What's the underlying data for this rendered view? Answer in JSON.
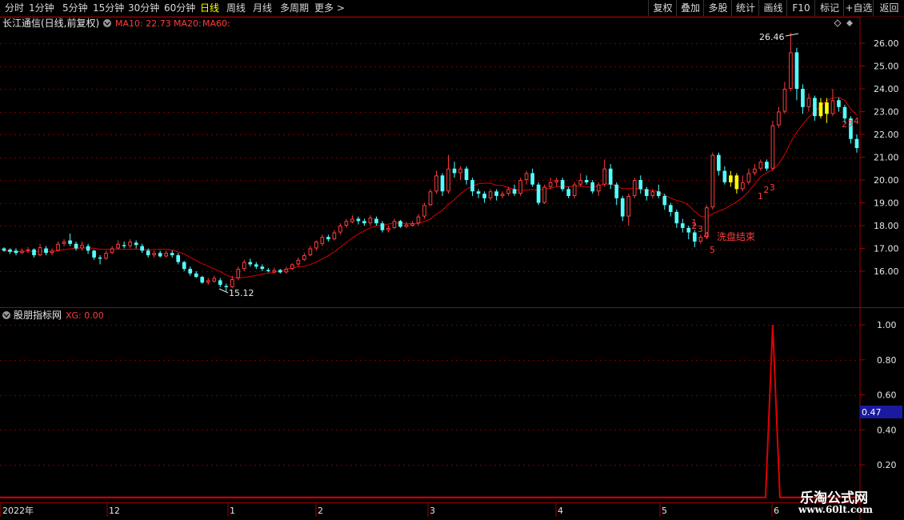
{
  "toolbar": {
    "left_items": [
      "分时",
      "1分钟",
      "5分钟",
      "15分钟",
      "30分钟",
      "60分钟",
      "日线",
      "周线",
      "月线",
      "多周期",
      "更多 >"
    ],
    "active": "日线",
    "right_items": [
      "复权",
      "叠加",
      "多股",
      "统计",
      "画线",
      "F10",
      "标记",
      "+自选",
      "返回"
    ]
  },
  "main_pane": {
    "stock": "长江通信(日线,前复权)",
    "ma10_label": "MA10: 22.73",
    "ma20_label": "MA20:",
    "ma60_label": "MA60:",
    "high_label": "26.46",
    "low_label": "15.12",
    "annotation": "洗盘结束",
    "counts": [
      "1",
      "2",
      "3",
      "4",
      "5",
      "1",
      "2",
      "3",
      "2",
      "3",
      "4"
    ],
    "y_ticks": [
      "26.00",
      "25.00",
      "24.00",
      "23.00",
      "22.00",
      "21.00",
      "20.00",
      "19.00",
      "18.00",
      "17.00",
      "16.00"
    ]
  },
  "sub_pane": {
    "name": "股朋指标网",
    "xg_label": "XG: 0.00",
    "y_ticks": [
      "1.00",
      "0.80",
      "0.60",
      "0.40",
      "0.20"
    ],
    "cursor_value": "0.47"
  },
  "x_axis": {
    "labels": [
      "2022年",
      "12",
      "1",
      "2",
      "3",
      "4",
      "5",
      "6"
    ]
  },
  "watermark": {
    "line1": "乐淘公式网",
    "line2": "www.60lt.com"
  },
  "colors": {
    "up": "#ff3c3c",
    "down": "#54ffff",
    "ma10": "#e00000",
    "signal": "#ffff00",
    "grid": "#7a0000",
    "axis_text": "#e6e6e6"
  },
  "chart_data": {
    "type": "candlestick",
    "price_range": [
      15.12,
      26.46
    ],
    "indicator": {
      "name": "XG",
      "ylim": [
        0,
        1.0
      ],
      "spike_value": 1.0,
      "spike_at_candle_index": 128
    },
    "candles": [
      [
        17.0,
        16.9,
        17.05,
        16.85
      ],
      [
        16.95,
        16.85,
        17.0,
        16.75
      ],
      [
        16.9,
        16.8,
        17.0,
        16.7
      ],
      [
        16.8,
        16.9,
        17.0,
        16.75
      ],
      [
        16.9,
        16.95,
        17.05,
        16.8
      ],
      [
        16.95,
        16.7,
        17.0,
        16.6
      ],
      [
        16.7,
        17.05,
        17.2,
        16.65
      ],
      [
        17.0,
        16.8,
        17.1,
        16.7
      ],
      [
        16.8,
        16.9,
        17.0,
        16.7
      ],
      [
        16.9,
        17.2,
        17.3,
        16.85
      ],
      [
        17.2,
        17.3,
        17.4,
        17.1
      ],
      [
        17.35,
        17.2,
        17.65,
        17.1
      ],
      [
        17.2,
        17.0,
        17.3,
        16.9
      ],
      [
        17.0,
        17.15,
        17.3,
        16.9
      ],
      [
        17.1,
        16.9,
        17.2,
        16.75
      ],
      [
        16.9,
        16.6,
        16.95,
        16.5
      ],
      [
        16.6,
        16.55,
        16.7,
        16.3
      ],
      [
        16.55,
        16.8,
        16.9,
        16.5
      ],
      [
        16.8,
        17.0,
        17.1,
        16.75
      ],
      [
        17.0,
        17.2,
        17.35,
        16.95
      ],
      [
        17.15,
        17.1,
        17.3,
        17.0
      ],
      [
        17.1,
        17.3,
        17.4,
        17.0
      ],
      [
        17.25,
        17.15,
        17.35,
        17.0
      ],
      [
        17.1,
        16.9,
        17.2,
        16.8
      ],
      [
        16.9,
        16.7,
        17.0,
        16.6
      ],
      [
        16.7,
        16.8,
        16.9,
        16.6
      ],
      [
        16.8,
        16.65,
        16.9,
        16.6
      ],
      [
        16.65,
        16.8,
        16.9,
        16.6
      ],
      [
        16.8,
        16.7,
        16.9,
        16.6
      ],
      [
        16.7,
        16.4,
        16.8,
        16.3
      ],
      [
        16.4,
        16.1,
        16.45,
        16.0
      ],
      [
        16.1,
        15.9,
        16.2,
        15.8
      ],
      [
        15.9,
        15.75,
        16.0,
        15.7
      ],
      [
        15.75,
        15.5,
        15.8,
        15.45
      ],
      [
        15.5,
        15.6,
        15.7,
        15.4
      ],
      [
        15.55,
        15.7,
        15.8,
        15.5
      ],
      [
        15.6,
        15.4,
        15.7,
        15.3
      ],
      [
        15.35,
        15.3,
        15.45,
        15.12
      ],
      [
        15.3,
        15.65,
        15.8,
        15.25
      ],
      [
        15.7,
        16.1,
        16.2,
        15.6
      ],
      [
        16.1,
        16.4,
        16.5,
        16.0
      ],
      [
        16.4,
        16.3,
        16.55,
        16.2
      ],
      [
        16.3,
        16.2,
        16.4,
        16.1
      ],
      [
        16.2,
        16.1,
        16.3,
        16.0
      ],
      [
        16.05,
        16.0,
        16.15,
        15.95
      ],
      [
        15.95,
        16.05,
        16.15,
        15.9
      ],
      [
        16.05,
        15.95,
        16.1,
        15.9
      ],
      [
        15.95,
        16.1,
        16.2,
        15.9
      ],
      [
        16.1,
        16.3,
        16.35,
        16.05
      ],
      [
        16.3,
        16.5,
        16.6,
        16.2
      ],
      [
        16.5,
        16.7,
        16.8,
        16.45
      ],
      [
        16.7,
        17.0,
        17.1,
        16.65
      ],
      [
        17.0,
        17.3,
        17.35,
        16.9
      ],
      [
        17.2,
        17.5,
        17.6,
        17.1
      ],
      [
        17.5,
        17.4,
        17.6,
        17.3
      ],
      [
        17.4,
        17.7,
        17.8,
        17.35
      ],
      [
        17.7,
        18.0,
        18.1,
        17.6
      ],
      [
        18.0,
        18.2,
        18.3,
        17.9
      ],
      [
        18.15,
        18.3,
        18.45,
        18.1
      ],
      [
        18.3,
        18.2,
        18.4,
        18.05
      ],
      [
        18.2,
        18.1,
        18.3,
        18.0
      ],
      [
        18.1,
        18.35,
        18.45,
        18.0
      ],
      [
        18.3,
        18.1,
        18.4,
        18.0
      ],
      [
        18.1,
        17.8,
        18.2,
        17.7
      ],
      [
        17.8,
        17.9,
        18.0,
        17.7
      ],
      [
        17.9,
        18.2,
        18.3,
        17.85
      ],
      [
        18.2,
        17.95,
        18.25,
        17.9
      ],
      [
        17.95,
        18.05,
        18.15,
        17.9
      ],
      [
        18.0,
        18.1,
        18.2,
        17.95
      ],
      [
        18.1,
        18.4,
        18.5,
        18.0
      ],
      [
        18.4,
        18.9,
        19.0,
        18.3
      ],
      [
        18.9,
        19.5,
        19.6,
        18.85
      ],
      [
        19.5,
        20.2,
        20.4,
        19.4
      ],
      [
        20.2,
        19.5,
        20.3,
        19.3
      ],
      [
        19.5,
        20.5,
        21.1,
        19.4
      ],
      [
        20.5,
        20.3,
        20.8,
        20.1
      ],
      [
        20.3,
        20.5,
        20.6,
        20.0
      ],
      [
        20.5,
        20.0,
        20.6,
        19.8
      ],
      [
        20.0,
        19.5,
        20.1,
        19.3
      ],
      [
        19.5,
        19.4,
        19.6,
        19.2
      ],
      [
        19.4,
        19.2,
        19.5,
        19.0
      ],
      [
        19.2,
        19.5,
        19.6,
        19.1
      ],
      [
        19.5,
        19.3,
        19.6,
        19.1
      ],
      [
        19.3,
        19.4,
        19.5,
        19.2
      ],
      [
        19.4,
        19.6,
        19.7,
        19.3
      ],
      [
        19.6,
        19.4,
        19.8,
        19.3
      ],
      [
        19.4,
        20.0,
        20.1,
        19.3
      ],
      [
        20.0,
        20.3,
        20.4,
        19.8
      ],
      [
        20.3,
        19.8,
        20.5,
        19.7
      ],
      [
        19.8,
        19.0,
        19.9,
        18.9
      ],
      [
        19.0,
        19.7,
        19.8,
        18.95
      ],
      [
        19.7,
        19.9,
        20.1,
        19.6
      ],
      [
        19.9,
        20.0,
        20.1,
        19.7
      ],
      [
        20.0,
        19.6,
        20.1,
        19.5
      ],
      [
        19.6,
        19.3,
        19.7,
        19.2
      ],
      [
        19.3,
        19.8,
        19.9,
        19.2
      ],
      [
        19.8,
        20.0,
        20.3,
        19.7
      ],
      [
        20.0,
        19.9,
        20.2,
        19.8
      ],
      [
        19.9,
        19.5,
        20.0,
        19.4
      ],
      [
        19.5,
        19.8,
        19.9,
        19.3
      ],
      [
        19.8,
        20.5,
        20.9,
        19.7
      ],
      [
        20.5,
        19.8,
        20.7,
        19.6
      ],
      [
        19.8,
        19.2,
        19.9,
        18.9
      ],
      [
        19.2,
        18.4,
        19.3,
        18.2
      ],
      [
        18.4,
        19.3,
        19.4,
        18.0
      ],
      [
        19.3,
        20.0,
        20.1,
        19.2
      ],
      [
        20.0,
        19.6,
        20.2,
        19.4
      ],
      [
        19.6,
        19.3,
        19.7,
        19.1
      ],
      [
        19.3,
        19.5,
        19.6,
        19.2
      ],
      [
        19.5,
        19.3,
        19.8,
        19.2
      ],
      [
        19.3,
        18.9,
        19.4,
        18.7
      ],
      [
        18.9,
        18.6,
        19.0,
        18.4
      ],
      [
        18.6,
        18.1,
        18.7,
        17.9
      ],
      [
        18.1,
        17.9,
        18.3,
        17.7
      ],
      [
        17.9,
        17.7,
        18.0,
        17.4
      ],
      [
        17.7,
        17.3,
        17.8,
        17.05
      ],
      [
        17.3,
        17.5,
        17.6,
        17.2
      ],
      [
        17.5,
        18.8,
        18.9,
        17.4
      ],
      [
        18.8,
        21.1,
        21.2,
        18.7
      ],
      [
        21.1,
        20.4,
        21.2,
        20.2
      ],
      [
        20.4,
        19.9,
        20.6,
        19.8
      ],
      [
        19.9,
        20.2,
        20.4,
        19.7
      ],
      [
        20.2,
        19.6,
        20.3,
        19.4
      ],
      [
        19.6,
        19.9,
        20.2,
        19.5
      ],
      [
        19.9,
        20.3,
        20.5,
        19.8
      ],
      [
        20.3,
        20.5,
        20.7,
        20.2
      ],
      [
        20.5,
        20.8,
        20.9,
        20.4
      ],
      [
        20.8,
        20.5,
        20.9,
        20.4
      ],
      [
        20.5,
        22.4,
        22.6,
        20.4
      ],
      [
        22.4,
        23.0,
        23.2,
        22.3
      ],
      [
        23.0,
        24.0,
        24.3,
        22.9
      ],
      [
        24.0,
        25.6,
        26.46,
        23.9
      ],
      [
        25.6,
        24.0,
        25.8,
        23.5
      ],
      [
        24.0,
        23.2,
        24.2,
        22.9
      ],
      [
        23.2,
        23.6,
        23.8,
        23.0
      ],
      [
        23.6,
        22.8,
        23.7,
        22.6
      ],
      [
        22.8,
        23.4,
        23.6,
        22.7
      ],
      [
        23.4,
        22.9,
        23.6,
        22.5
      ],
      [
        22.9,
        23.5,
        24.0,
        22.8
      ],
      [
        23.5,
        23.2,
        23.6,
        23.0
      ],
      [
        23.2,
        22.7,
        23.3,
        22.5
      ],
      [
        22.7,
        21.8,
        22.8,
        21.6
      ],
      [
        21.8,
        21.4,
        22.0,
        21.2
      ]
    ],
    "signals": [
      121,
      122,
      136,
      137
    ]
  }
}
